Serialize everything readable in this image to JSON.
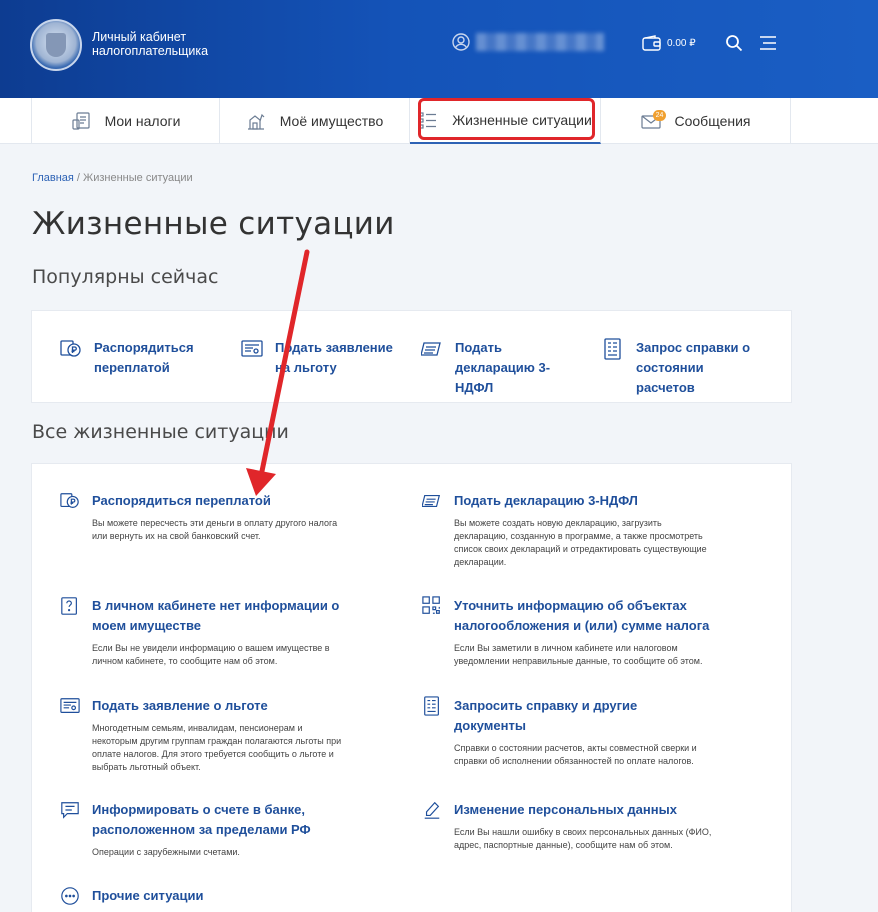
{
  "header": {
    "brand_line1": "Личный кабинет",
    "brand_line2": "налогоплательщика",
    "balance": "0.00 ₽"
  },
  "tabs": [
    {
      "label": "Мои налоги",
      "icon": "taxes-icon"
    },
    {
      "label": "Моё имущество",
      "icon": "property-icon"
    },
    {
      "label": "Жизненные ситуации",
      "icon": "list-icon",
      "active": true
    },
    {
      "label": "Сообщения",
      "icon": "envelope-icon",
      "badge": "24"
    }
  ],
  "breadcrumb": {
    "home": "Главная",
    "separator": " / ",
    "current": "Жизненные ситуации"
  },
  "page_title": "Жизненные ситуации",
  "popular": {
    "heading": "Популярны сейчас",
    "items": [
      {
        "label": "Распорядиться переплатой",
        "icon": "ruble-icon"
      },
      {
        "label": "Подать заявление на льготу",
        "icon": "application-icon"
      },
      {
        "label": "Подать декларацию 3-НДФЛ",
        "icon": "declaration-icon"
      },
      {
        "label": "Запрос справки о состоянии расчетов",
        "icon": "document-icon"
      }
    ]
  },
  "all": {
    "heading": "Все жизненные ситуации",
    "items": [
      {
        "title": "Распорядиться переплатой",
        "desc": "Вы можете пересчесть эти деньги в оплату другого налога или вернуть их на свой банковский счет.",
        "icon": "ruble-icon"
      },
      {
        "title": "Подать декларацию 3-НДФЛ",
        "desc": "Вы можете создать новую декларацию, загрузить декларацию, созданную в программе, а также просмотреть список своих деклараций и отредактировать существующие декларации.",
        "icon": "declaration-icon"
      },
      {
        "title": "В личном кабинете нет информации о моем имуществе",
        "desc": "Если Вы не увидели информацию о вашем имуществе в личном кабинете, то сообщите нам об этом.",
        "icon": "question-icon"
      },
      {
        "title": "Уточнить информацию об объектах налогообложения и (или) сумме налога",
        "desc": "Если Вы заметили в личном кабинете или налоговом уведомлении неправильные данные, то сообщите об этом.",
        "icon": "qr-icon"
      },
      {
        "title": "Подать заявление о льготе",
        "desc": "Многодетным семьям, инвалидам, пенсионерам и некоторым другим группам граждан полагаются льготы при оплате налогов. Для этого требуется сообщить о льготе и выбрать льготный объект.",
        "icon": "application-icon"
      },
      {
        "title": "Запросить справку и другие документы",
        "desc": "Справки о состоянии расчетов, акты совместной сверки и справки об исполнении обязанностей по оплате налогов.",
        "icon": "document-icon"
      },
      {
        "title": "Информировать о счете в банке, расположенном за пределами РФ",
        "desc": "Операции с зарубежными счетами.",
        "icon": "chat-icon"
      },
      {
        "title": "Изменение персональных данных",
        "desc": "Если Вы нашли ошибку в своих персональных данных (ФИО, адрес, паспортные данные), сообщите нам об этом.",
        "icon": "pen-icon"
      },
      {
        "title": "Прочие ситуации",
        "desc": "",
        "icon": "more-icon"
      }
    ]
  },
  "colors": {
    "header": "#1453b8",
    "link": "#1f4f9b",
    "highlight": "#e0262a",
    "arrow": "#e0262a"
  }
}
